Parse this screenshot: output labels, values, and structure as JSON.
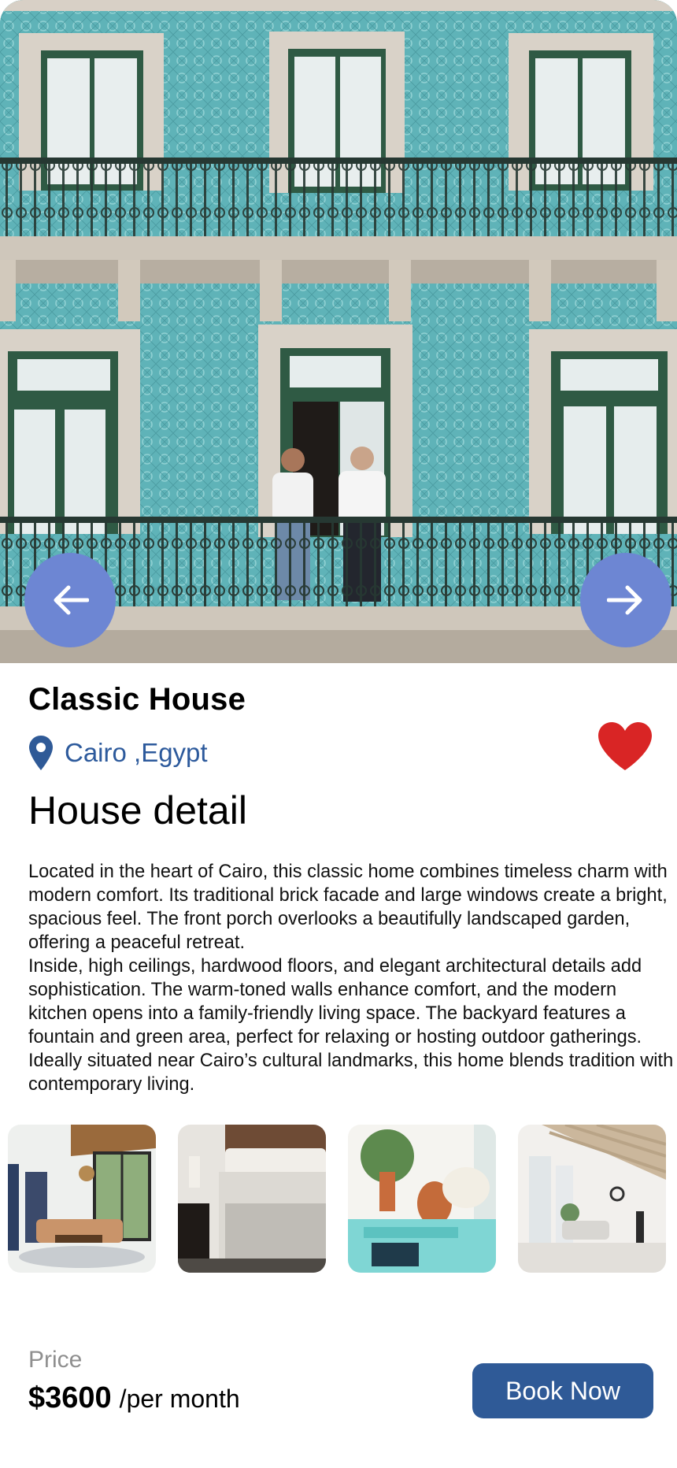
{
  "property": {
    "title": "Classic House",
    "location": "Cairo ,Egypt",
    "favorited": true
  },
  "detail": {
    "heading": "House detail",
    "paragraphs": [
      "Located in the heart of Cairo, this classic home combines timeless charm with modern comfort. Its traditional brick facade and large windows create a bright, spacious feel. The front porch overlooks a beautifully landscaped garden, offering a peaceful retreat.",
      "Inside, high ceilings, hardwood floors, and elegant architectural details add sophistication. The warm-toned walls enhance comfort, and the modern kitchen opens into a family-friendly living space. The backyard features a fountain and green area, perfect for relaxing or hosting outdoor gatherings. Ideally situated near Cairo’s cultural landmarks, this home blends tradition with contemporary living."
    ]
  },
  "carousel": {
    "prev_icon": "arrow-left-icon",
    "next_icon": "arrow-right-icon"
  },
  "gallery": [
    "living-room-photo",
    "bedroom-photo",
    "lounge-photo",
    "sunroom-photo"
  ],
  "pricing": {
    "label": "Price",
    "amount": "$3600",
    "unit": "/per month"
  },
  "actions": {
    "book_label": "Book Now"
  },
  "colors": {
    "accent": "#2f5a97",
    "nav_button": "#6d86d3",
    "favorite": "#d92525",
    "facade": "#5fb3b8"
  }
}
